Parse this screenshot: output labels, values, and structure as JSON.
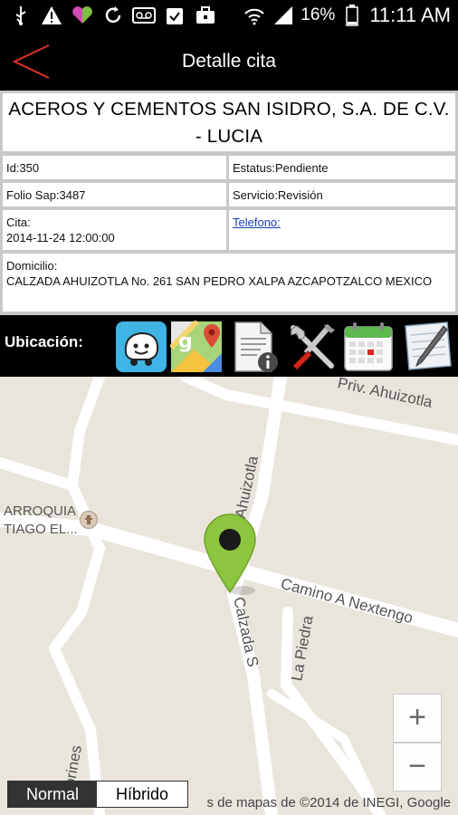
{
  "status": {
    "battery": "16%",
    "time": "11:11 AM"
  },
  "header": {
    "title": "Detalle cita"
  },
  "company": "ACEROS Y CEMENTOS SAN ISIDRO, S.A. DE C.V. - LUCIA",
  "details": {
    "id": "Id:350",
    "estatus": "Estatus:Pendiente",
    "folio": "Folio Sap:3487",
    "servicio": "Servicio:Revisión",
    "cita_label": "Cita:",
    "cita_value": "2014-11-24 12:00:00",
    "telefono": "Telefono:",
    "domicilio_label": "Domicilio:",
    "domicilio_value": "CALZADA AHUIZOTLA No. 261 SAN PEDRO XALPA AZCAPOTZALCO MEXICO"
  },
  "iconbar": {
    "label": "Ubicación:",
    "icons": [
      "waze-icon",
      "google-maps-icon",
      "document-info-icon",
      "tools-icon",
      "calendar-icon",
      "notepad-icon"
    ]
  },
  "map": {
    "streets": [
      "Priv. Ahuizotla",
      "Ahuizotla",
      "Camino A Nextengo",
      "Calzada S",
      "La Piedra",
      "orines"
    ],
    "poi": [
      "ARROQUIA",
      "TIAGO EL..."
    ],
    "zoom_in": "+",
    "zoom_out": "−",
    "type_normal": "Normal",
    "type_hibrido": "Híbrido",
    "attribution": "s de mapas de ©2014 de INEGI, Google"
  },
  "colors": {
    "back_arrow": "#e0322b",
    "marker": "#8cc63e",
    "link": "#1a3eb8"
  }
}
